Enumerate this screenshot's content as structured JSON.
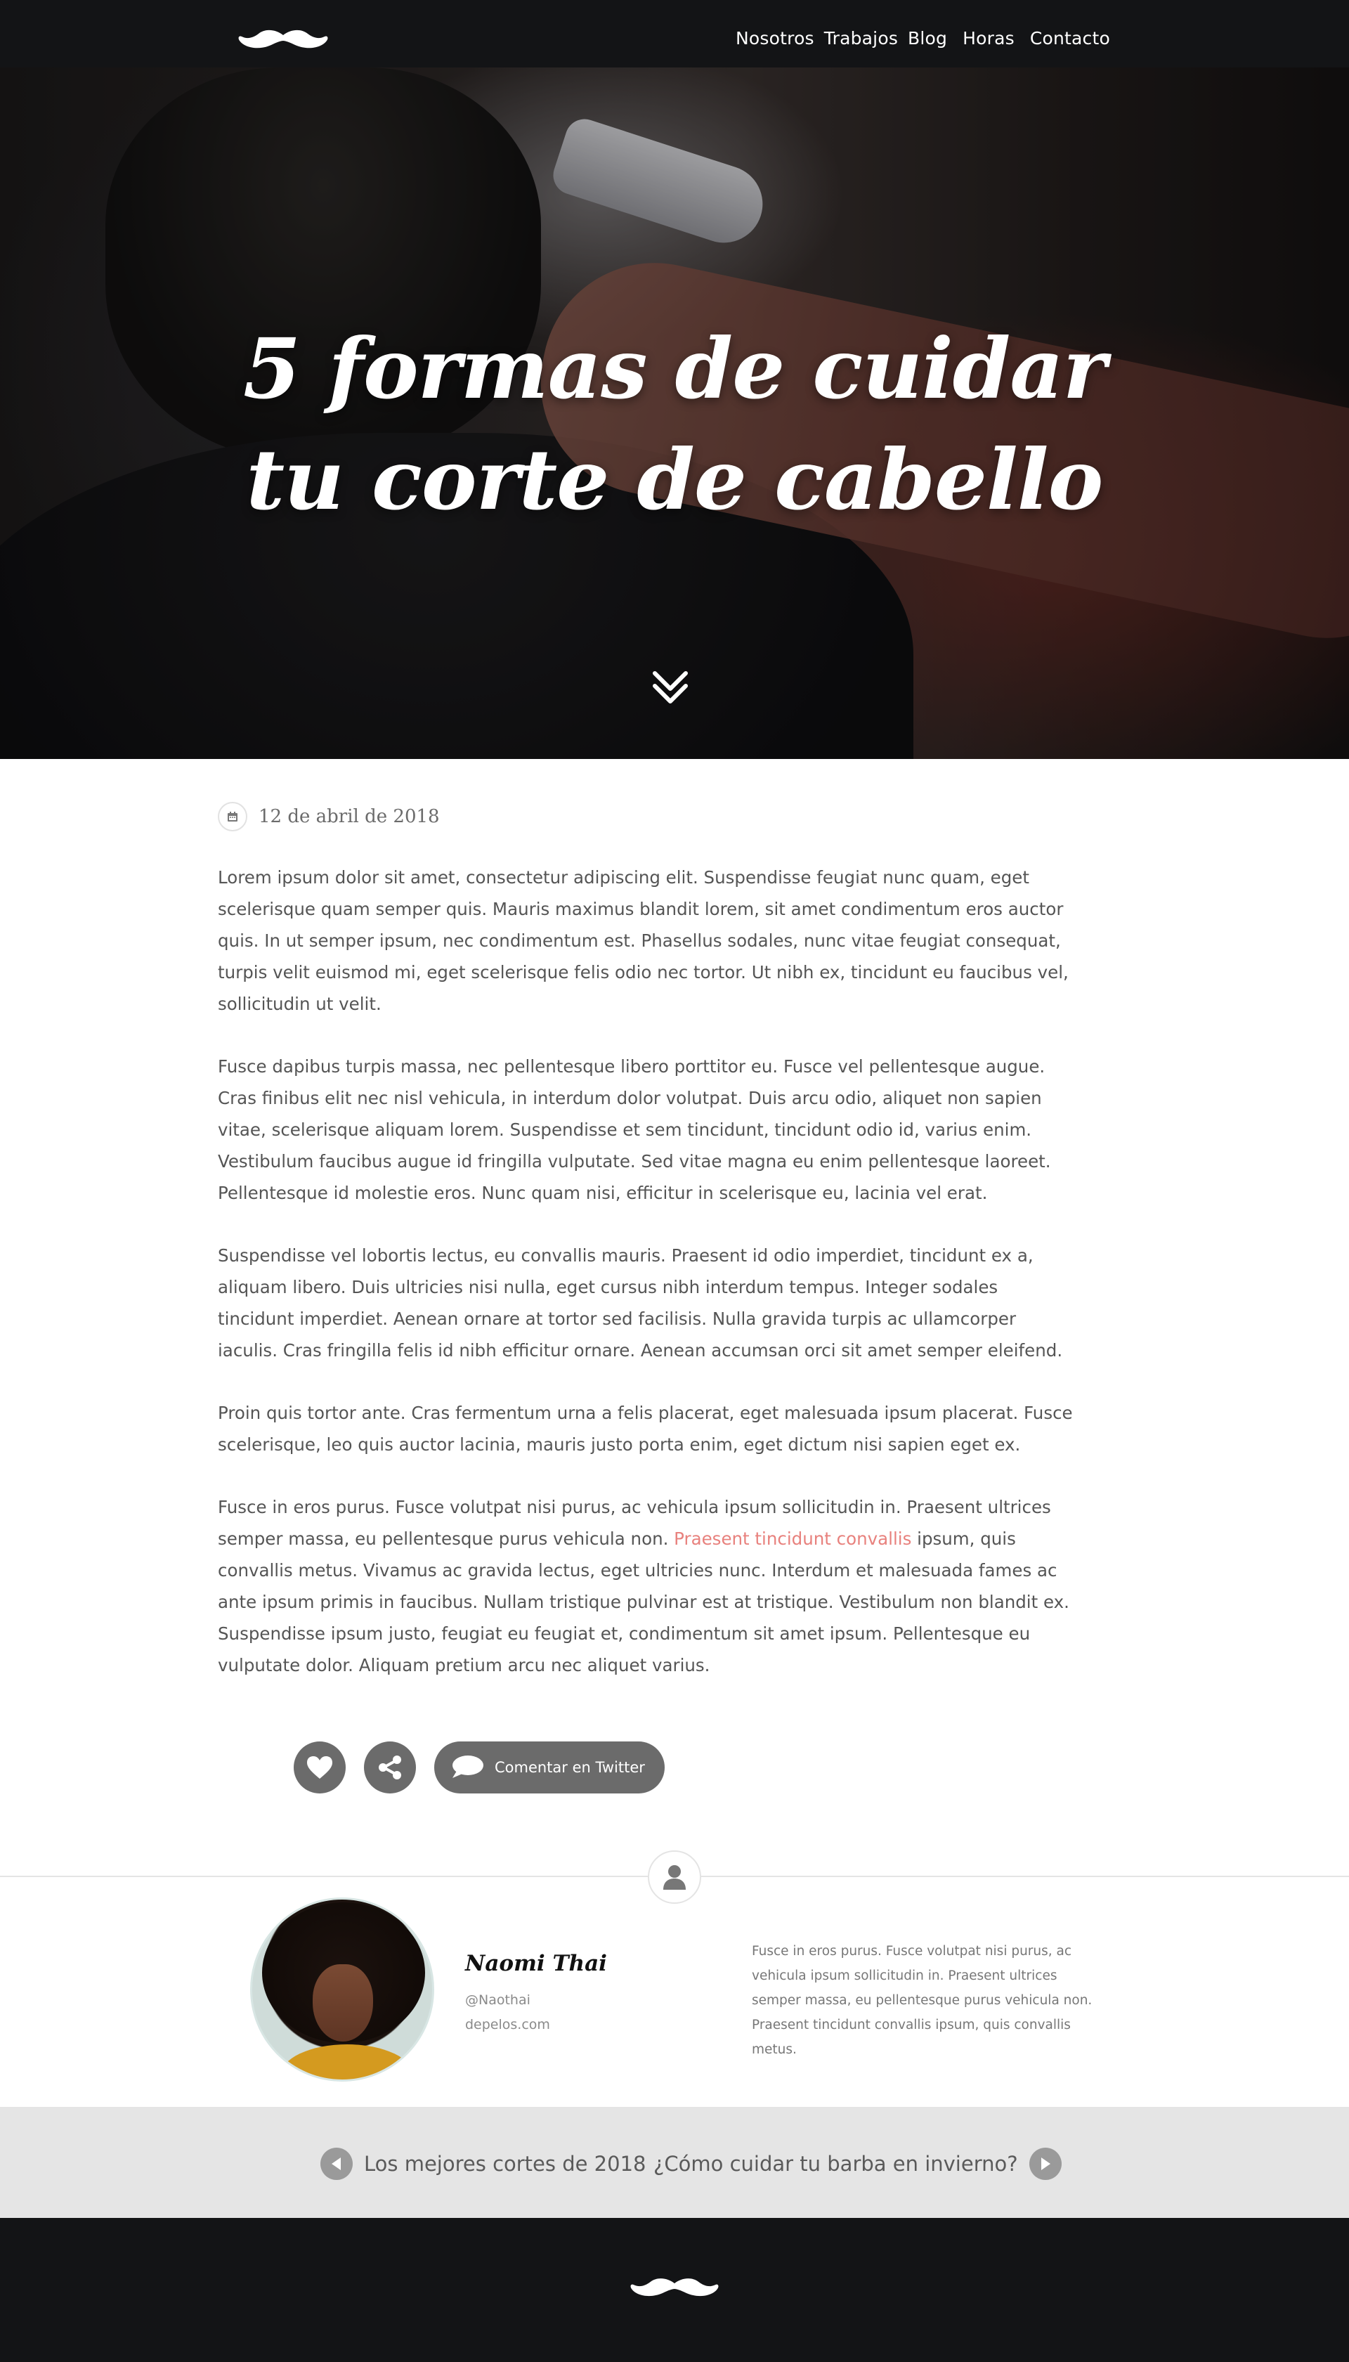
{
  "header": {
    "logo_icon": "mustache-icon",
    "nav": [
      "Nosotros",
      "Trabajos",
      "Blog",
      "Horas",
      "Contacto"
    ]
  },
  "hero": {
    "title_line1": "5 formas de cuidar",
    "title_line2": "tu corte de cabello",
    "scroll_icon": "double-chevron-down-icon"
  },
  "post": {
    "date_icon": "calendar-icon",
    "date": "12 de abril de 2018",
    "paragraphs": [
      "Lorem ipsum dolor sit amet, consectetur adipiscing elit. Suspendisse feugiat nunc quam, eget scelerisque quam semper quis. Mauris maximus blandit lorem, sit amet condimentum eros auctor quis. In ut semper ipsum, nec condimentum est. Phasellus sodales, nunc vitae feugiat consequat, turpis velit euismod mi, eget scelerisque felis odio nec tortor. Ut nibh ex, tincidunt eu faucibus vel, sollicitudin ut velit.",
      "Fusce dapibus turpis massa, nec pellentesque libero porttitor eu. Fusce vel pellentesque augue. Cras finibus elit nec nisl vehicula, in interdum dolor volutpat. Duis arcu odio, aliquet non sapien vitae, scelerisque aliquam lorem. Suspendisse et sem tincidunt, tincidunt odio id, varius enim. Vestibulum faucibus augue id fringilla vulputate. Sed vitae magna eu enim pellentesque laoreet. Pellentesque id molestie eros. Nunc quam nisi, efficitur in scelerisque eu, lacinia vel erat.",
      "Suspendisse vel lobortis lectus, eu convallis mauris. Praesent id odio imperdiet, tincidunt ex a, aliquam libero. Duis ultricies nisi nulla, eget cursus nibh interdum tempus. Integer sodales tincidunt imperdiet. Aenean ornare at tortor sed facilisis. Nulla gravida turpis ac ullamcorper iaculis. Cras fringilla felis id nibh efficitur ornare. Aenean accumsan orci sit amet semper eleifend.",
      "Proin quis tortor ante. Cras fermentum urna a felis placerat, eget malesuada ipsum placerat. Fusce scelerisque, leo quis auctor lacinia, mauris justo porta enim, eget dictum nisi sapien eget ex."
    ],
    "p5_before": "Fusce in eros purus. Fusce volutpat nisi purus, ac vehicula ipsum sollicitudin in. Praesent ultrices semper massa, eu pellentesque purus vehicula non. ",
    "p5_link": "Praesent tincidunt convallis",
    "p5_after": " ipsum, quis convallis metus. Vivamus ac gravida lectus, eget ultricies nunc. Interdum et malesuada fames ac ante ipsum primis in faucibus. Nullam tristique pulvinar est at tristique. Vestibulum non blandit ex. Suspendisse ipsum justo, feugiat eu feugiat et, condimentum sit amet ipsum. Pellentesque eu vulputate dolor. Aliquam pretium arcu nec aliquet varius.",
    "link_color": "#e8817d"
  },
  "actions": {
    "like_icon": "heart-icon",
    "share_icon": "share-icon",
    "comment_icon": "speech-bubble-icon",
    "comment_label": "Comentar en Twitter"
  },
  "author": {
    "badge_icon": "user-icon",
    "name": "Naomi Thai",
    "handle": "@Naothai",
    "site": "depelos.com",
    "bio": "Fusce in eros purus. Fusce volutpat nisi purus, ac vehicula ipsum sollicitudin in. Praesent ultrices semper massa, eu pellentesque purus vehicula non. Praesent tincidunt convallis ipsum, quis convallis metus."
  },
  "postnav": {
    "prev_label": "Los mejores cortes de 2018",
    "next_label": "¿Cómo cuidar tu barba en invierno?",
    "prev_icon": "triangle-left-icon",
    "next_icon": "triangle-right-icon"
  },
  "footer": {
    "logo_icon": "mustache-icon"
  }
}
